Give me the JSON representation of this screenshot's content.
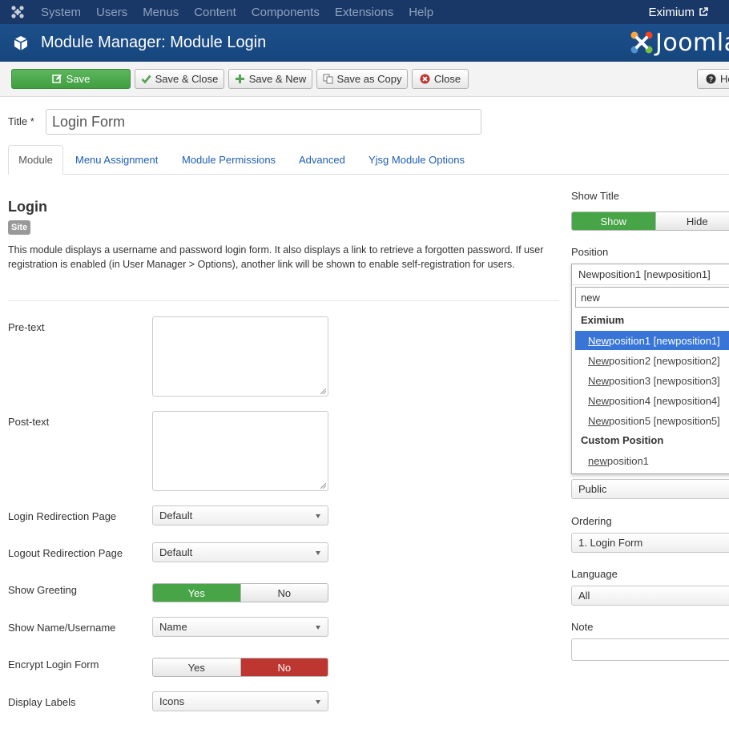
{
  "topnav": {
    "menu": [
      "System",
      "Users",
      "Menus",
      "Content",
      "Components",
      "Extensions",
      "Help"
    ],
    "site_name": "Eximium"
  },
  "header": {
    "title": "Module Manager: Module Login",
    "brand": "Joomla"
  },
  "toolbar": {
    "save": "Save",
    "save_close": "Save & Close",
    "save_new": "Save & New",
    "save_copy": "Save as Copy",
    "close": "Close",
    "help": "He"
  },
  "form": {
    "title_label": "Title *",
    "title_value": "Login Form"
  },
  "tabs": [
    "Module",
    "Menu Assignment",
    "Module Permissions",
    "Advanced",
    "Yjsg Module Options"
  ],
  "module": {
    "name": "Login",
    "badge": "Site",
    "description": "This module displays a username and password login form. It also displays a link to retrieve a forgotten password. If user registration is enabled (in User Manager > Options), another link will be shown to enable self-registration for users."
  },
  "fields": {
    "pretext_label": "Pre-text",
    "posttext_label": "Post-text",
    "login_redirect_label": "Login Redirection Page",
    "login_redirect_value": "Default",
    "logout_redirect_label": "Logout Redirection Page",
    "logout_redirect_value": "Default",
    "greeting_label": "Show Greeting",
    "greeting_yes": "Yes",
    "greeting_no": "No",
    "name_label": "Show Name/Username",
    "name_value": "Name",
    "encrypt_label": "Encrypt Login Form",
    "encrypt_yes": "Yes",
    "encrypt_no": "No",
    "labels_label": "Display Labels",
    "labels_value": "Icons"
  },
  "right": {
    "show_title_label": "Show Title",
    "show": "Show",
    "hide": "Hide",
    "position_label": "Position",
    "position_value": "Newposition1 [newposition1]",
    "search_value": "new",
    "group1": "Eximium",
    "options": [
      {
        "match": "New",
        "rest": "position1 [newposition1]"
      },
      {
        "match": "New",
        "rest": "position2 [newposition2]"
      },
      {
        "match": "New",
        "rest": "position3 [newposition3]"
      },
      {
        "match": "New",
        "rest": "position4 [newposition4]"
      },
      {
        "match": "New",
        "rest": "position5 [newposition5]"
      }
    ],
    "group2": "Custom Position",
    "custom": {
      "match": "new",
      "rest": "position1"
    },
    "access_value": "Public",
    "ordering_label": "Ordering",
    "ordering_value": "1. Login Form",
    "language_label": "Language",
    "language_value": "All",
    "note_label": "Note"
  },
  "colors": {
    "nav": "#1a3867",
    "header": "#1c4f8a",
    "save_green": "#47a447",
    "no_red": "#bd362f",
    "highlight": "#3875d7",
    "tab_link": "#1f5eb0"
  }
}
